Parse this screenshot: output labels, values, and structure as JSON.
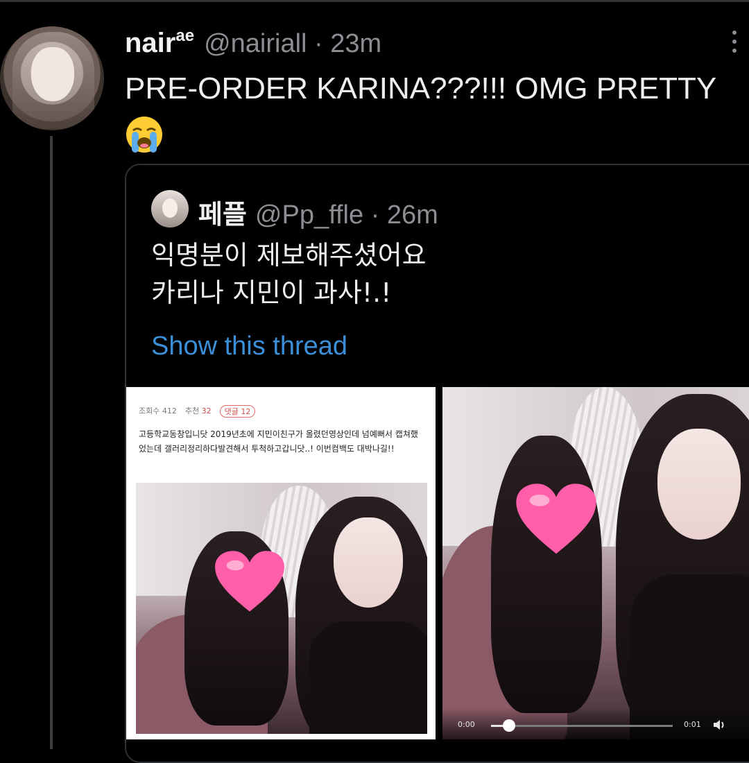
{
  "tweet": {
    "author_name": "nair",
    "author_name_sup": "ae",
    "handle_time": "@nairiall · 23m",
    "text": "PRE-ORDER KARINA???!!! OMG PRETTY",
    "emoji": "loudly-crying-face"
  },
  "quoted": {
    "author_name": "페플",
    "handle_time": "@Pp_ffle · 26m",
    "lines": [
      "익명분이 제보해주셨어요",
      "카리나 지민이 과사!.!"
    ],
    "show_thread": "Show this thread"
  },
  "media_left": {
    "meta": {
      "views": "조회수 412",
      "likes_label": "추천",
      "likes_value": "32",
      "comments": "댓글 12"
    },
    "body": "고등학교동창입니닷 2019년초에 지민이친구가 올렸던영상인데 넘예뻐서 캡쳐했었는데 갤러리정리하다발견해서 투척하고갑니닷..! 이번컴백도 대박나길!!"
  },
  "video": {
    "time_current": "0:00",
    "time_total": "0:01",
    "progress": 0.1
  },
  "colors": {
    "background": "#000000",
    "link": "#3b8fd8",
    "muted": "#8b8f94",
    "heart": "#ff5fa8"
  }
}
